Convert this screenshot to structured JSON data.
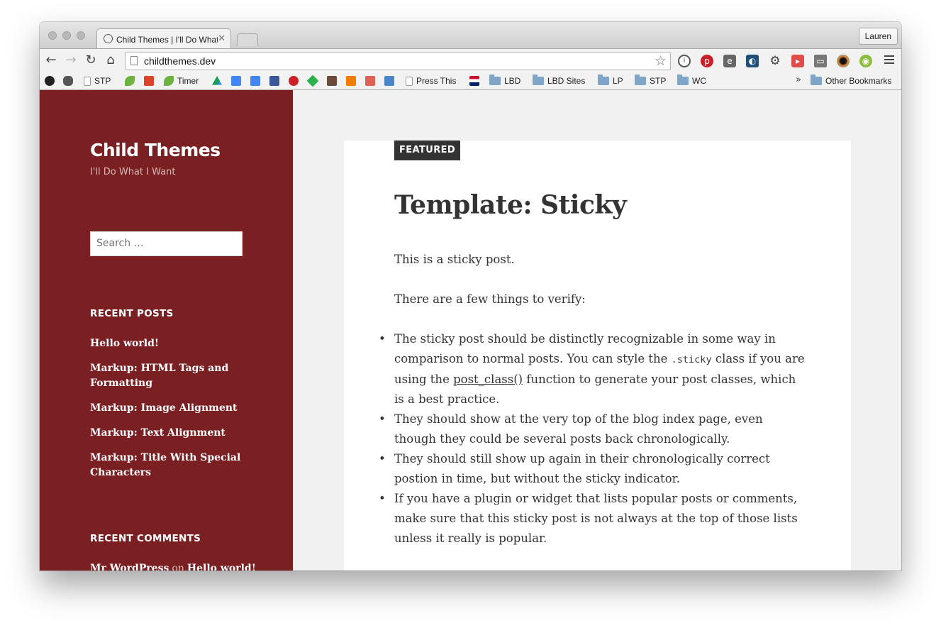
{
  "browser": {
    "tab_title": "Child Themes | I'll Do What I Want",
    "profile_name": "Lauren",
    "url": "childthemes.dev",
    "bookmarks": {
      "stp": "STP",
      "timer": "Timer",
      "press_this": "Press This",
      "lbd": "LBD",
      "lbd_sites": "LBD Sites",
      "lp": "LP",
      "stp_folder": "STP",
      "wc": "WC",
      "overflow": "»",
      "other": "Other Bookmarks"
    }
  },
  "site": {
    "title": "Child Themes",
    "description": "I'll Do What I Want",
    "search_placeholder": "Search …"
  },
  "recent_posts": {
    "heading": "RECENT POSTS",
    "items": [
      "Hello world!",
      "Markup: HTML Tags and Formatting",
      "Markup: Image Alignment",
      "Markup: Text Alignment",
      "Markup: Title With Special Characters"
    ]
  },
  "recent_comments": {
    "heading": "RECENT COMMENTS",
    "author": "Mr WordPress",
    "separator": "on",
    "post": "Hello world!"
  },
  "post": {
    "badge": "FEATURED",
    "title": "Template: Sticky",
    "intro": "This is a sticky post.",
    "lead": "There are a few things to verify:",
    "bullet1_a": "The sticky post should be distinctly recognizable in some way in comparison to normal posts. You can style the ",
    "bullet1_code": ".sticky",
    "bullet1_b": " class if you are using the ",
    "bullet1_link": "post_class()",
    "bullet1_c": " function to generate your post classes, which is a best practice.",
    "bullet2": "They should show at the very top of the blog index page, even though they could be several posts back chronologically.",
    "bullet3": "They should still show up again in their chronologically correct postion in time, but without the sticky indicator.",
    "bullet4": "If you have a plugin or widget that lists popular posts or comments, make sure that this sticky post is not always at the top of those lists unless it really is popular."
  },
  "colors": {
    "sidebar": "#7a1f22",
    "page_bg": "#f1f1f1",
    "badge_bg": "#333333"
  }
}
